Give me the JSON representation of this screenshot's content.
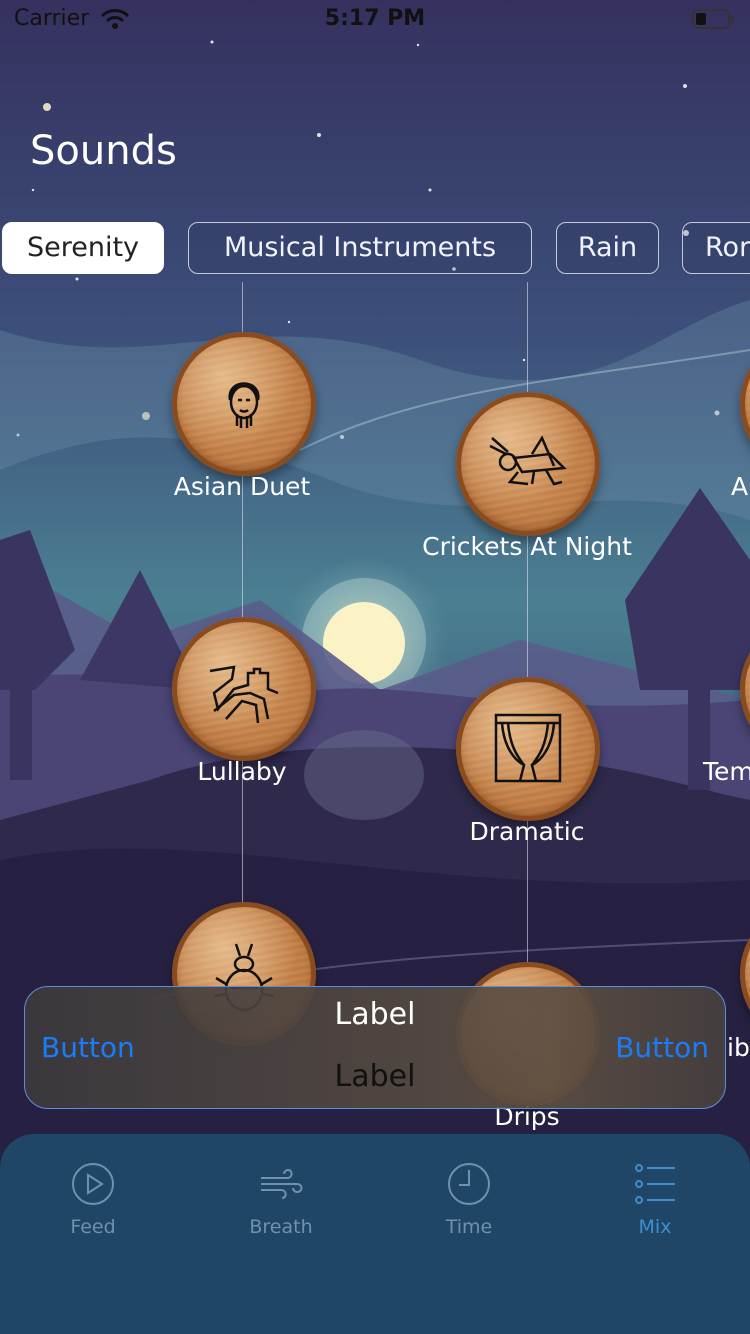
{
  "status_bar": {
    "carrier": "Carrier",
    "time": "5:17 PM"
  },
  "page_title": "Sounds",
  "tabs": [
    {
      "label": "Serenity",
      "active": true
    },
    {
      "label": "Musical Instruments",
      "active": false
    },
    {
      "label": "Rain",
      "active": false
    },
    {
      "label": "Ror",
      "active": false
    }
  ],
  "sounds": [
    {
      "label": "Asian Duet",
      "icon": "bearded-man-icon"
    },
    {
      "label": "Crickets At Night",
      "icon": "cricket-icon"
    },
    {
      "label": "A",
      "icon": "partial-icon"
    },
    {
      "label": "Lullaby",
      "icon": "great-wall-icon"
    },
    {
      "label": "Dramatic",
      "icon": "theater-curtain-icon"
    },
    {
      "label": "Tem",
      "icon": "partial-icon"
    },
    {
      "label": "Drips",
      "icon": "drops-icon"
    },
    {
      "label": "",
      "icon": "beetle-icon"
    }
  ],
  "player": {
    "left_button": "Button",
    "right_button": "Button",
    "label_top": "Label",
    "label_bottom": "Label",
    "hidden_label_fragment": "ibe"
  },
  "tabbar": [
    {
      "label": "Feed",
      "icon": "play-circle-icon",
      "active": false
    },
    {
      "label": "Breath",
      "icon": "wind-icon",
      "active": false
    },
    {
      "label": "Time",
      "icon": "clock-icon",
      "active": false
    },
    {
      "label": "Mix",
      "icon": "list-icon",
      "active": true
    }
  ],
  "colors": {
    "accent": "#1a7cf6",
    "tabbar_bg": "#1f4667",
    "tabbar_active": "#3f8ed0",
    "tabbar_inactive": "#7190ad"
  }
}
